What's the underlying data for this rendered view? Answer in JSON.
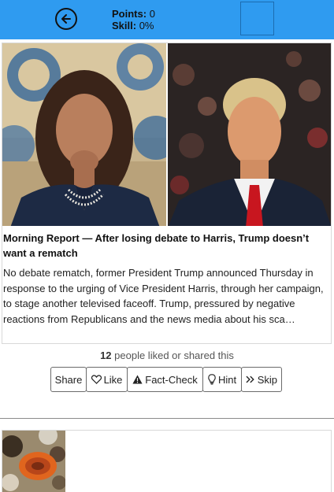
{
  "header": {
    "points_label": "Points:",
    "points_value": "0",
    "skill_label": "Skill:",
    "skill_value": "0%",
    "back_icon": "back-arrow-icon",
    "bar_color": "#2f9bf0"
  },
  "article": {
    "headline": "Morning Report — After losing debate to Harris, Trump doesn’t want a rematch",
    "summary": "No debate rematch, former President Trump announced Thursday in response to the urging of Vice President Harris, through her campaign, to stage another televised faceoff. Trump, pressured by negative reactions from Republicans and the news media about his sca…",
    "likes_count": "12",
    "likes_text": "people liked or shared this"
  },
  "actions": {
    "share": "Share",
    "like": "Like",
    "fact_check": "Fact-Check",
    "hint": "Hint",
    "skip": "Skip",
    "like_icon": "heart-icon",
    "fact_check_icon": "warning-icon",
    "hint_icon": "lightbulb-icon",
    "skip_icon": "double-chevron-right-icon"
  }
}
